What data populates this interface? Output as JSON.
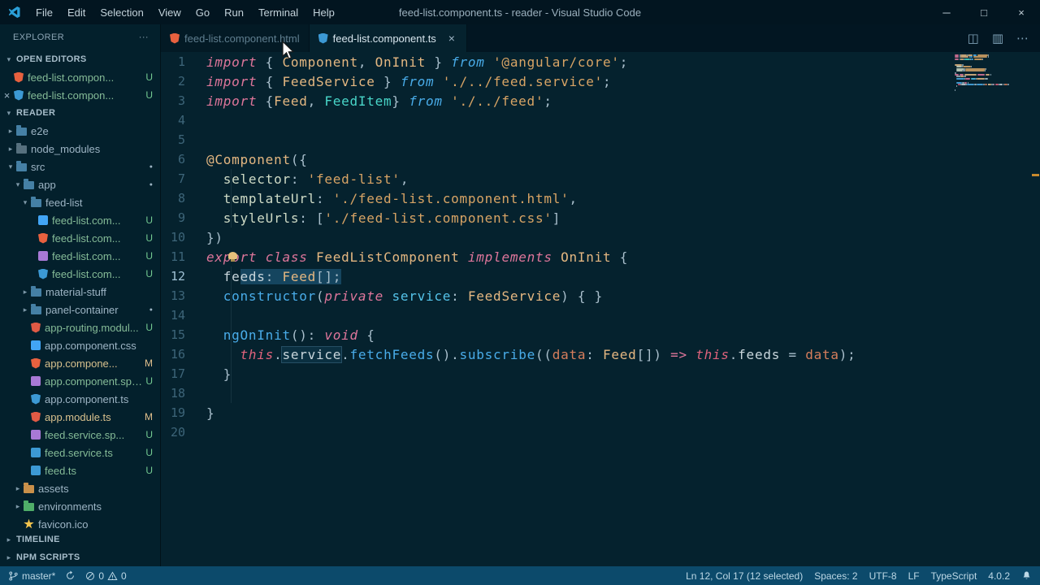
{
  "titlebar": {
    "menus": [
      "File",
      "Edit",
      "Selection",
      "View",
      "Go",
      "Run",
      "Terminal",
      "Help"
    ],
    "title": "feed-list.component.ts - reader - Visual Studio Code"
  },
  "icons": {
    "chevron_down": "▾",
    "chevron_right": "▸",
    "close": "×",
    "more": "···",
    "ellipsis": "⋯",
    "split_editor": "◫",
    "layout": "▥",
    "minimize": "─",
    "maximize": "□",
    "modified_dot": "●"
  },
  "sidebar": {
    "explorer_label": "EXPLORER",
    "open_editors": {
      "label": "OPEN EDITORS",
      "items": [
        {
          "name": "feed-list.compon...",
          "badge": "U",
          "close": false,
          "icon": {
            "shape": "shield",
            "color": "#e8613f"
          }
        },
        {
          "name": "feed-list.compon...",
          "badge": "U",
          "close": true,
          "icon": {
            "shape": "shield",
            "color": "#3c99d4"
          }
        }
      ]
    },
    "tree_label": "READER",
    "timeline_label": "TIMELINE",
    "npm_label": "NPM SCRIPTS",
    "tree": {
      "items": [
        {
          "name": "e2e",
          "kind": "folder",
          "level": 0,
          "expanded": false,
          "icon": {
            "shape": "folder",
            "color": "#4580a5"
          },
          "badge": ""
        },
        {
          "name": "node_modules",
          "kind": "folder",
          "level": 0,
          "expanded": false,
          "icon": {
            "shape": "folder",
            "color": "#56707e"
          },
          "badge": ""
        },
        {
          "name": "src",
          "kind": "folder",
          "level": 0,
          "expanded": true,
          "icon": {
            "shape": "folder",
            "color": "#4580a5"
          },
          "badge": "",
          "dot": true
        },
        {
          "name": "app",
          "kind": "folder",
          "level": 1,
          "expanded": true,
          "icon": {
            "shape": "folder",
            "color": "#4580a5"
          },
          "badge": "",
          "dot": true
        },
        {
          "name": "feed-list",
          "kind": "folder",
          "level": 2,
          "expanded": true,
          "icon": {
            "shape": "folder",
            "color": "#4580a5"
          },
          "badge": ""
        },
        {
          "name": "feed-list.com...",
          "kind": "file",
          "level": 3,
          "icon": {
            "shape": "square",
            "color": "#42a5f5"
          },
          "badge": "U"
        },
        {
          "name": "feed-list.com...",
          "kind": "file",
          "level": 3,
          "icon": {
            "shape": "shield",
            "color": "#e8613f"
          },
          "badge": "U"
        },
        {
          "name": "feed-list.com...",
          "kind": "file",
          "level": 3,
          "icon": {
            "shape": "square",
            "color": "#a879d6"
          },
          "badge": "U"
        },
        {
          "name": "feed-list.com...",
          "kind": "file",
          "level": 3,
          "icon": {
            "shape": "shield",
            "color": "#3c99d4"
          },
          "badge": "U"
        },
        {
          "name": "material-stuff",
          "kind": "folder",
          "level": 2,
          "expanded": false,
          "icon": {
            "shape": "folder",
            "color": "#4580a5"
          },
          "badge": ""
        },
        {
          "name": "panel-container",
          "kind": "folder",
          "level": 2,
          "expanded": false,
          "icon": {
            "shape": "folder",
            "color": "#4580a5"
          },
          "badge": "",
          "dot": true
        },
        {
          "name": "app-routing.modul...",
          "kind": "file",
          "level": 2,
          "icon": {
            "shape": "shield",
            "color": "#e05a45"
          },
          "badge": "U"
        },
        {
          "name": "app.component.css",
          "kind": "file",
          "level": 2,
          "icon": {
            "shape": "square",
            "color": "#42a5f5"
          },
          "badge": ""
        },
        {
          "name": "app.compone...",
          "kind": "file",
          "level": 2,
          "icon": {
            "shape": "shield",
            "color": "#e8613f"
          },
          "badge": "M"
        },
        {
          "name": "app.component.spe...",
          "kind": "file",
          "level": 2,
          "icon": {
            "shape": "square",
            "color": "#a879d6"
          },
          "badge": "U"
        },
        {
          "name": "app.component.ts",
          "kind": "file",
          "level": 2,
          "icon": {
            "shape": "shield",
            "color": "#3c99d4"
          },
          "badge": ""
        },
        {
          "name": "app.module.ts",
          "kind": "file",
          "level": 2,
          "icon": {
            "shape": "shield",
            "color": "#e05a45"
          },
          "badge": "M"
        },
        {
          "name": "feed.service.sp...",
          "kind": "file",
          "level": 2,
          "icon": {
            "shape": "square",
            "color": "#a879d6"
          },
          "badge": "U"
        },
        {
          "name": "feed.service.ts",
          "kind": "file",
          "level": 2,
          "icon": {
            "shape": "square",
            "color": "#3c99d4"
          },
          "badge": "U"
        },
        {
          "name": "feed.ts",
          "kind": "file",
          "level": 2,
          "icon": {
            "shape": "square",
            "color": "#3c99d4"
          },
          "badge": "U"
        },
        {
          "name": "assets",
          "kind": "folder",
          "level": 1,
          "expanded": false,
          "icon": {
            "shape": "folder",
            "color": "#c9904a"
          },
          "badge": ""
        },
        {
          "name": "environments",
          "kind": "folder",
          "level": 1,
          "expanded": false,
          "icon": {
            "shape": "folder",
            "color": "#4fae69"
          },
          "badge": ""
        },
        {
          "name": "favicon.ico",
          "kind": "file",
          "level": 1,
          "icon": {
            "shape": "star",
            "color": "#f2c44d"
          },
          "badge": ""
        }
      ]
    }
  },
  "tabs": [
    {
      "label": "feed-list.component.html",
      "active": false,
      "close": false,
      "icon": {
        "shape": "shield",
        "color": "#e8613f"
      }
    },
    {
      "label": "feed-list.component.ts",
      "active": true,
      "close": true,
      "icon": {
        "shape": "shield",
        "color": "#3c99d4"
      }
    }
  ],
  "editor": {
    "guides": [
      {
        "from": 7,
        "to": 9
      },
      {
        "from": 12,
        "to": 18
      }
    ],
    "lines": [
      {
        "t": [
          [
            "import",
            "kw"
          ],
          [
            " { ",
            "p"
          ],
          [
            "Component",
            "type"
          ],
          [
            ", ",
            "p"
          ],
          [
            "OnInit",
            "type"
          ],
          [
            " } ",
            "p"
          ],
          [
            "from",
            "ctrl"
          ],
          [
            " ",
            "p"
          ],
          [
            "'@angular/core'",
            "str"
          ],
          [
            ";",
            "p"
          ]
        ]
      },
      {
        "t": [
          [
            "import",
            "kw"
          ],
          [
            " { ",
            "p"
          ],
          [
            "FeedService",
            "type"
          ],
          [
            " } ",
            "p"
          ],
          [
            "from",
            "ctrl"
          ],
          [
            " ",
            "p"
          ],
          [
            "'./../feed.service'",
            "str"
          ],
          [
            ";",
            "p"
          ]
        ]
      },
      {
        "t": [
          [
            "import",
            "kw"
          ],
          [
            " {",
            "p"
          ],
          [
            "Feed",
            "type"
          ],
          [
            ", ",
            "p"
          ],
          [
            "FeedItem",
            "iface"
          ],
          [
            "} ",
            "p"
          ],
          [
            "from",
            "ctrl"
          ],
          [
            " ",
            "p"
          ],
          [
            "'./../feed'",
            "str"
          ],
          [
            ";",
            "p"
          ]
        ]
      },
      {
        "t": []
      },
      {
        "t": []
      },
      {
        "t": [
          [
            "@Component",
            "type"
          ],
          [
            "({",
            "p"
          ]
        ]
      },
      {
        "t": [
          [
            "  selector",
            "prop"
          ],
          [
            ": ",
            "p"
          ],
          [
            "'feed-list'",
            "str"
          ],
          [
            ",",
            "p"
          ]
        ]
      },
      {
        "t": [
          [
            "  templateUrl",
            "prop"
          ],
          [
            ": ",
            "p"
          ],
          [
            "'./feed-list.component.html'",
            "str"
          ],
          [
            ",",
            "p"
          ]
        ]
      },
      {
        "t": [
          [
            "  styleUrls",
            "prop"
          ],
          [
            ": [",
            "p"
          ],
          [
            "'./feed-list.component.css'",
            "str"
          ],
          [
            "]",
            "p"
          ]
        ]
      },
      {
        "t": [
          [
            "})",
            "p"
          ]
        ]
      },
      {
        "bulb": true,
        "t": [
          [
            "export",
            "kw"
          ],
          [
            " ",
            "p"
          ],
          [
            "class",
            "kw"
          ],
          [
            " ",
            "p"
          ],
          [
            "FeedListComponent",
            "type"
          ],
          [
            " ",
            "p"
          ],
          [
            "implements",
            "kw"
          ],
          [
            " ",
            "p"
          ],
          [
            "OnInit",
            "type"
          ],
          [
            " {",
            "p"
          ]
        ]
      },
      {
        "active": true,
        "t": [
          [
            "  fe",
            "v"
          ],
          [
            "eds",
            "v",
            1
          ],
          [
            ": ",
            "p",
            1
          ],
          [
            "Feed",
            "type",
            1
          ],
          [
            "[]",
            "p",
            1
          ],
          [
            ";",
            "p",
            1
          ]
        ]
      },
      {
        "t": [
          [
            "  constructor",
            "fn"
          ],
          [
            "(",
            "p"
          ],
          [
            "private",
            "kw"
          ],
          [
            " ",
            "p"
          ],
          [
            "service",
            "parm"
          ],
          [
            ": ",
            "p"
          ],
          [
            "FeedService",
            "type"
          ],
          [
            ") { }",
            "p"
          ]
        ]
      },
      {
        "t": []
      },
      {
        "t": [
          [
            "  ngOnInit",
            "fn"
          ],
          [
            "(): ",
            "p"
          ],
          [
            "void",
            "kw"
          ],
          [
            " {",
            "p"
          ]
        ]
      },
      {
        "t": [
          [
            "    this",
            "th"
          ],
          [
            ".",
            "p"
          ],
          [
            "service",
            "v",
            "occ"
          ],
          [
            ".",
            "p"
          ],
          [
            "fetchFeeds",
            "fn"
          ],
          [
            "().",
            "p"
          ],
          [
            "subscribe",
            "fn"
          ],
          [
            "((",
            "p"
          ],
          [
            "data",
            "parm2"
          ],
          [
            ": ",
            "p"
          ],
          [
            "Feed",
            "type"
          ],
          [
            "[]",
            "p"
          ],
          [
            ") ",
            "p"
          ],
          [
            "=>",
            "op"
          ],
          [
            " ",
            "p"
          ],
          [
            "this",
            "th"
          ],
          [
            ".",
            "p"
          ],
          [
            "feeds",
            "v"
          ],
          [
            " = ",
            "p"
          ],
          [
            "data",
            "parm2"
          ],
          [
            ");",
            "p"
          ]
        ]
      },
      {
        "t": [
          [
            "  }",
            "p"
          ]
        ]
      },
      {
        "t": []
      },
      {
        "t": [
          [
            "}",
            "p"
          ]
        ]
      },
      {
        "t": []
      }
    ]
  },
  "statusbar": {
    "branch": "master*",
    "errors": "0",
    "warnings": "0",
    "cursor": "Ln 12, Col 17 (12 selected)",
    "spaces": "Spaces: 2",
    "encoding": "UTF-8",
    "eol": "LF",
    "language": "TypeScript",
    "ts_version": "4.0.2"
  },
  "colors": {
    "statusbar_bg": "#0c4a6b",
    "editor_bg": "#05222e",
    "sidebar_bg": "#03202c",
    "badge_untracked": "#73c991",
    "badge_modified": "#e2c08d",
    "selection": "#15455f",
    "ruler_mark": "#c98a2d",
    "tokens": {
      "kw": "#df769b",
      "ctrl": "#49ace9",
      "op": "#df769b",
      "type": "#e4b781",
      "iface": "#49d6c9",
      "str": "#d8a465",
      "fn": "#49ace9",
      "prop": "#cfdbc6",
      "v": "#c9d6dc",
      "p": "#a9bfcc",
      "th": "#e0637c",
      "parm": "#55c3e9",
      "parm2": "#d67e5c"
    }
  }
}
